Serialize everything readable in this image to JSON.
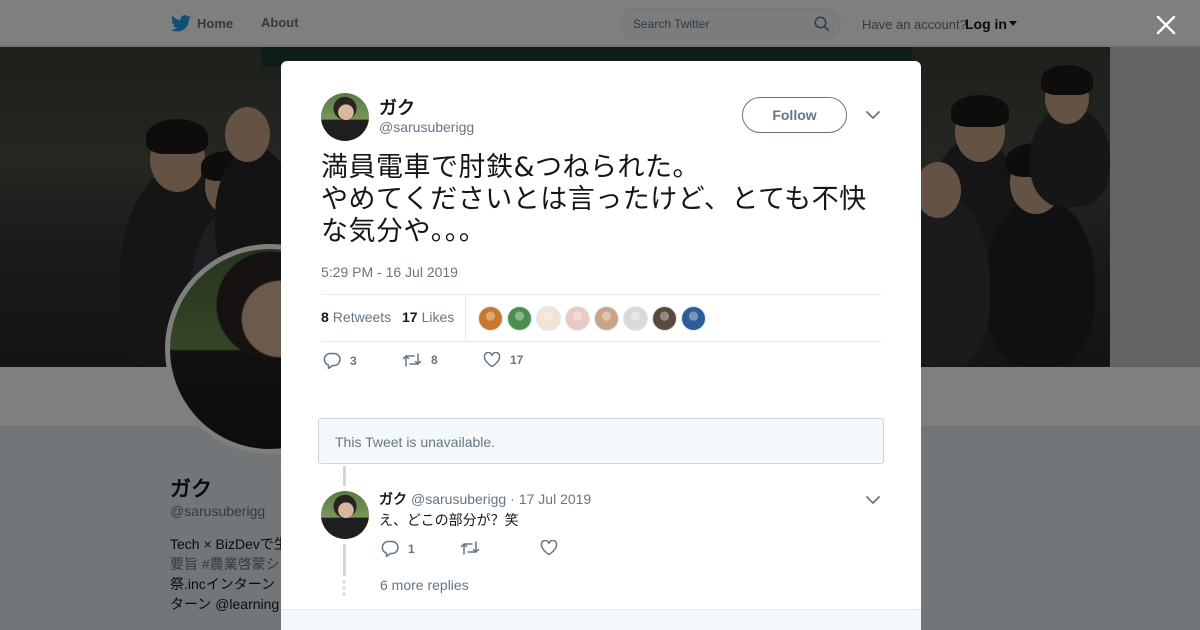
{
  "nav": {
    "home_label": "Home",
    "about_label": "About",
    "search_placeholder": "Search Twitter",
    "have_account": "Have an account?",
    "login_label": "Log in"
  },
  "profile": {
    "name": "ガク",
    "handle": "@sarusuberigg",
    "bio_lines": [
      "Tech × BizDevで生",
      "要旨 #農業啓蒙シ",
      "祭.incインターン",
      "ターン @learning"
    ]
  },
  "tweet": {
    "author_name": "ガク",
    "author_handle": "@sarusuberigg",
    "follow_label": "Follow",
    "text": "満員電車で肘鉄&つねられた。\nやめてくださいとは言ったけど、とても不快な気分や。。。",
    "timestamp": "5:29 PM - 16 Jul 2019",
    "retweets_count": "8",
    "retweets_label": "Retweets",
    "likes_count": "17",
    "likes_label": "Likes",
    "likers_colors": [
      "#c9782a",
      "#4a8f4f",
      "#f1e4d2",
      "#e9c9c4",
      "#c8a58a",
      "#d9d9d9",
      "#5a4a3a",
      "#2d5c9a"
    ],
    "reply_count": "3",
    "retweet_count_action": "8",
    "like_count_action": "17"
  },
  "unavailable_text": "This Tweet is unavailable.",
  "reply": {
    "name": "ガク",
    "handle": "@sarusuberigg",
    "separator": "·",
    "date": "17 Jul 2019",
    "text": "え、どこの部分が？笑",
    "reply_count": "1"
  },
  "more_replies": "6 more replies",
  "colors": {
    "twitter_blue": "#1da1f2",
    "muted": "#657786",
    "border": "#e6ecf0"
  }
}
